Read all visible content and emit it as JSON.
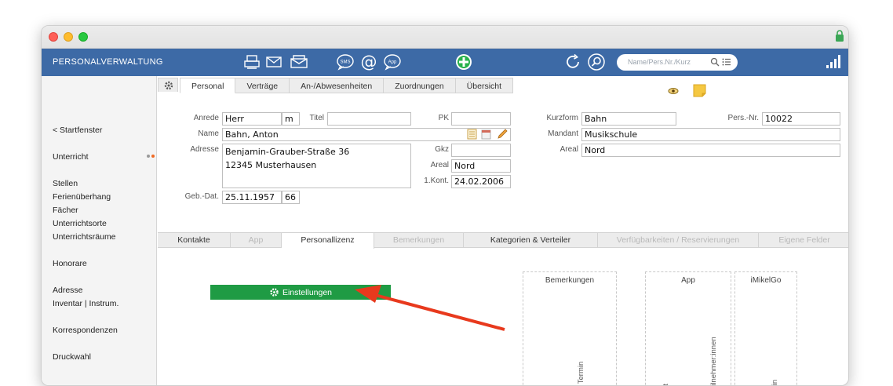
{
  "app": {
    "title": "PERSONALVERWALTUNG",
    "search_placeholder": "Name/Pers.Nr./Kurz"
  },
  "toolbar": {
    "icons": [
      "printer-icon",
      "mail-icon",
      "mail-open-icon",
      "sms-icon",
      "at-icon",
      "app-icon",
      "add-icon",
      "refresh-icon",
      "search-circle-icon"
    ],
    "sms_label": "SMS",
    "app_label": "App"
  },
  "sidebar": {
    "back": "< Startfenster",
    "items": [
      "Unterricht",
      "Stellen",
      "Ferienüberhang",
      "Fächer",
      "Unterrichtsorte",
      "Unterrichtsräume",
      "Honorare",
      "Adresse",
      "Inventar | Instrum.",
      "Korrespondenzen",
      "Druckwahl"
    ]
  },
  "tabs": [
    "Personal",
    "Verträge",
    "An-/Abwesenheiten",
    "Zuordnungen",
    "Übersicht"
  ],
  "form": {
    "anrede_label": "Anrede",
    "anrede": "Herr",
    "geschlecht": "m",
    "titel_label": "Titel",
    "titel": "",
    "pk_label": "PK",
    "pk": "",
    "name_label": "Name",
    "name": "Bahn, Anton",
    "adresse_label": "Adresse",
    "adresse_line1": "Benjamin-Grauber-Straße 36",
    "adresse_line2": "12345 Musterhausen",
    "gkz_label": "Gkz",
    "gkz": "",
    "areal_label": "Areal",
    "areal": "Nord",
    "kont_label": "1.Kont.",
    "kont": "24.02.2006",
    "geb_label": "Geb.-Dat.",
    "geb": "25.11.1957",
    "alter": "66",
    "kurzform_label": "Kurzform",
    "kurzform": "Bahn",
    "persnr_label": "Pers.-Nr.",
    "persnr": "10022",
    "mandant_label": "Mandant",
    "mandant": "Musikschule",
    "areal2_label": "Areal",
    "areal2": "Nord"
  },
  "subtabs": [
    {
      "label": "Kontakte",
      "state": "normal"
    },
    {
      "label": "App",
      "state": "disabled"
    },
    {
      "label": "Personallizenz",
      "state": "active"
    },
    {
      "label": "Bemerkungen",
      "state": "disabled"
    },
    {
      "label": "Kategorien & Verteiler",
      "state": "normal"
    },
    {
      "label": "Verfügbarkeiten / Reservierungen",
      "state": "disabled"
    },
    {
      "label": "Eigene Felder",
      "state": "disabled"
    }
  ],
  "license": {
    "settings_button": "Einstellungen",
    "columns": [
      "Bemerkungen",
      "App",
      "iMikelGo"
    ],
    "vertical_labels": [
      "n Termin",
      "ut",
      "eilnehmer:innen",
      "r:in"
    ]
  },
  "colors": {
    "topbar": "#3d6aa6",
    "accent_green": "#1f9b44",
    "annotation_arrow": "#e8391d"
  }
}
